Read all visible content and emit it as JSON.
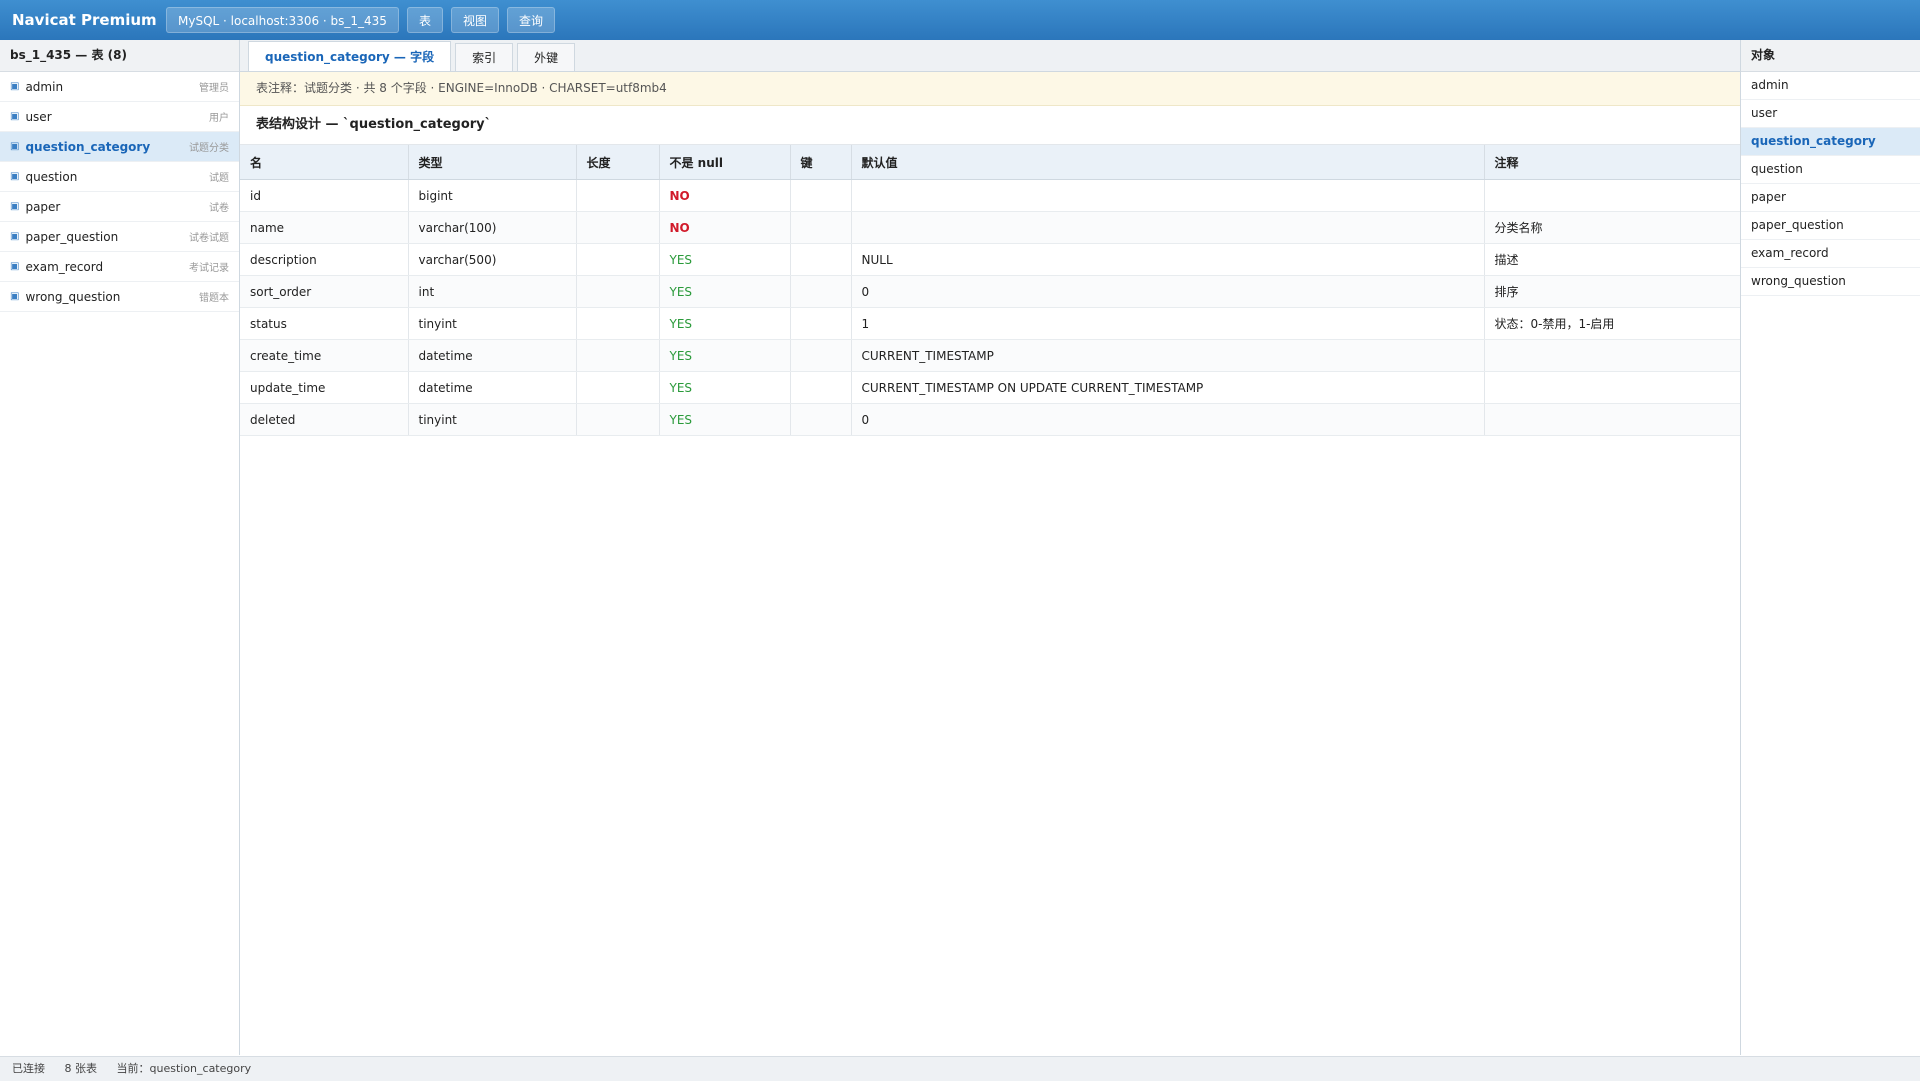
{
  "app": {
    "title": "Navicat Premium",
    "connection": "MySQL · localhost:3306 · bs_1_435",
    "buttons": [
      "表",
      "视图",
      "查询"
    ]
  },
  "left": {
    "header": "bs_1_435 — 表 (8)",
    "tables": [
      {
        "name": "admin",
        "comment": "管理员"
      },
      {
        "name": "user",
        "comment": "用户"
      },
      {
        "name": "question_category",
        "comment": "试题分类"
      },
      {
        "name": "question",
        "comment": "试题"
      },
      {
        "name": "paper",
        "comment": "试卷"
      },
      {
        "name": "paper_question",
        "comment": "试卷试题"
      },
      {
        "name": "exam_record",
        "comment": "考试记录"
      },
      {
        "name": "wrong_question",
        "comment": "错题本"
      }
    ]
  },
  "tabs": [
    "question_category — 字段",
    "索引",
    "外键"
  ],
  "notice": "表注释：试题分类 · 共 8 个字段 · ENGINE=InnoDB · CHARSET=utf8mb4",
  "section_title": "表结构设计 — `question_category`",
  "columns": [
    "名",
    "类型",
    "长度",
    "不是 null",
    "键",
    "默认值",
    "注释"
  ],
  "rows": [
    {
      "name": "id",
      "type": "bigint",
      "length": "",
      "not_null": "NO",
      "key": "",
      "default": "",
      "comment": ""
    },
    {
      "name": "name",
      "type": "varchar(100)",
      "length": "",
      "not_null": "NO",
      "key": "",
      "default": "",
      "comment": "分类名称"
    },
    {
      "name": "description",
      "type": "varchar(500)",
      "length": "",
      "not_null": "YES",
      "key": "",
      "default": "NULL",
      "comment": "描述"
    },
    {
      "name": "sort_order",
      "type": "int",
      "length": "",
      "not_null": "YES",
      "key": "",
      "default": "0",
      "comment": "排序"
    },
    {
      "name": "status",
      "type": "tinyint",
      "length": "",
      "not_null": "YES",
      "key": "",
      "default": "1",
      "comment": "状态：0-禁用，1-启用"
    },
    {
      "name": "create_time",
      "type": "datetime",
      "length": "",
      "not_null": "YES",
      "key": "",
      "default": "CURRENT_TIMESTAMP",
      "comment": ""
    },
    {
      "name": "update_time",
      "type": "datetime",
      "length": "",
      "not_null": "YES",
      "key": "",
      "default": "CURRENT_TIMESTAMP ON UPDATE CURRENT_TIMESTAMP",
      "comment": ""
    },
    {
      "name": "deleted",
      "type": "tinyint",
      "length": "",
      "not_null": "YES",
      "key": "",
      "default": "0",
      "comment": ""
    }
  ],
  "right": {
    "header": "对象",
    "items": [
      "admin",
      "user",
      "question_category",
      "question",
      "paper",
      "paper_question",
      "exam_record",
      "wrong_question"
    ]
  },
  "status": {
    "connected": "已连接",
    "count": "8 张表",
    "current": "当前：question_category"
  },
  "colors": {
    "accent": "#2b76bb",
    "selected_bg": "#dbeaf7",
    "no_red": "#d11a2a",
    "yes_green": "#2a9a3a"
  }
}
